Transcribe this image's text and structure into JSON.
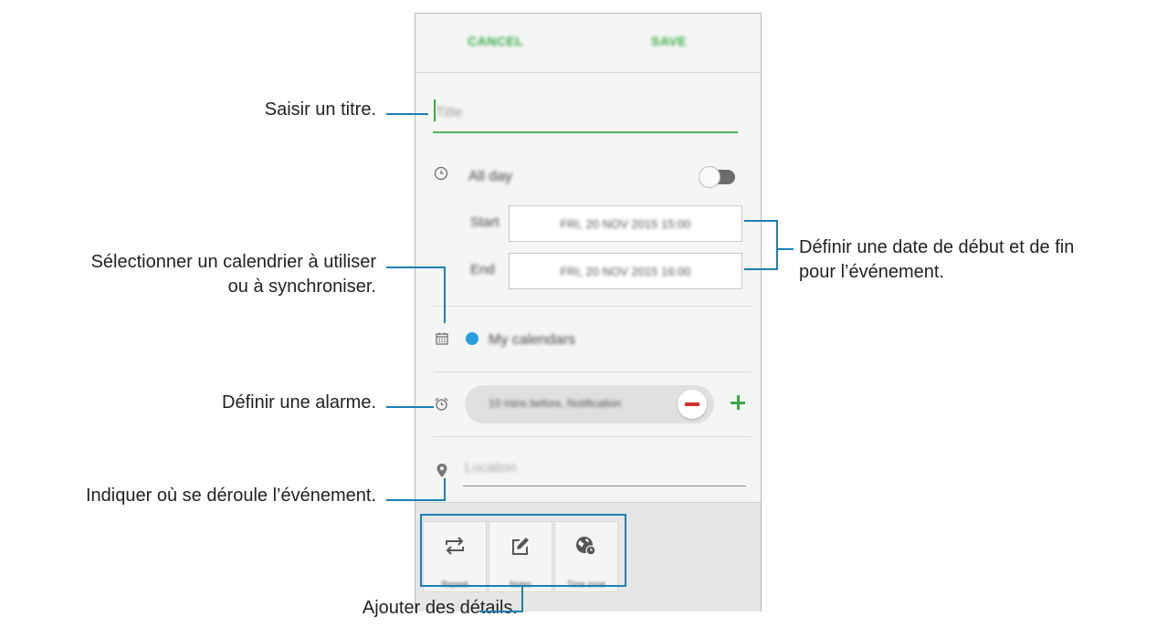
{
  "screen": {
    "toolbar": {
      "cancel_label": "CANCEL",
      "save_label": "SAVE"
    },
    "title_field": {
      "placeholder": "Title"
    },
    "all_day": {
      "label": "All day",
      "toggle_on": false
    },
    "start": {
      "label": "Start",
      "value": "FRI, 20 NOV 2015 15:00"
    },
    "end": {
      "label": "End",
      "value": "FRI, 20 NOV 2015 16:00"
    },
    "calendar": {
      "label": "My calendars",
      "color": "#2a9fe0"
    },
    "alarm": {
      "value": "10 mins before, Notification"
    },
    "location": {
      "placeholder": "Location"
    },
    "bottom_buttons": [
      {
        "label": "Repeat",
        "icon": "repeat-icon"
      },
      {
        "label": "Notes",
        "icon": "notes-icon"
      },
      {
        "label": "Time zone",
        "icon": "time-zone-icon"
      }
    ],
    "accent_color": "#3aa845"
  },
  "callouts": {
    "title": "Saisir un titre.",
    "calendar_line1": "Sélectionner un calendrier à utiliser",
    "calendar_line2": "ou à synchroniser.",
    "alarm": "Définir une alarme.",
    "location": "Indiquer où se déroule l’événement.",
    "details": "Ajouter des détails.",
    "dates_line1": "Définir une date de début et de fin",
    "dates_line2": "pour l’événement."
  },
  "line_color": "#1b7fb3"
}
